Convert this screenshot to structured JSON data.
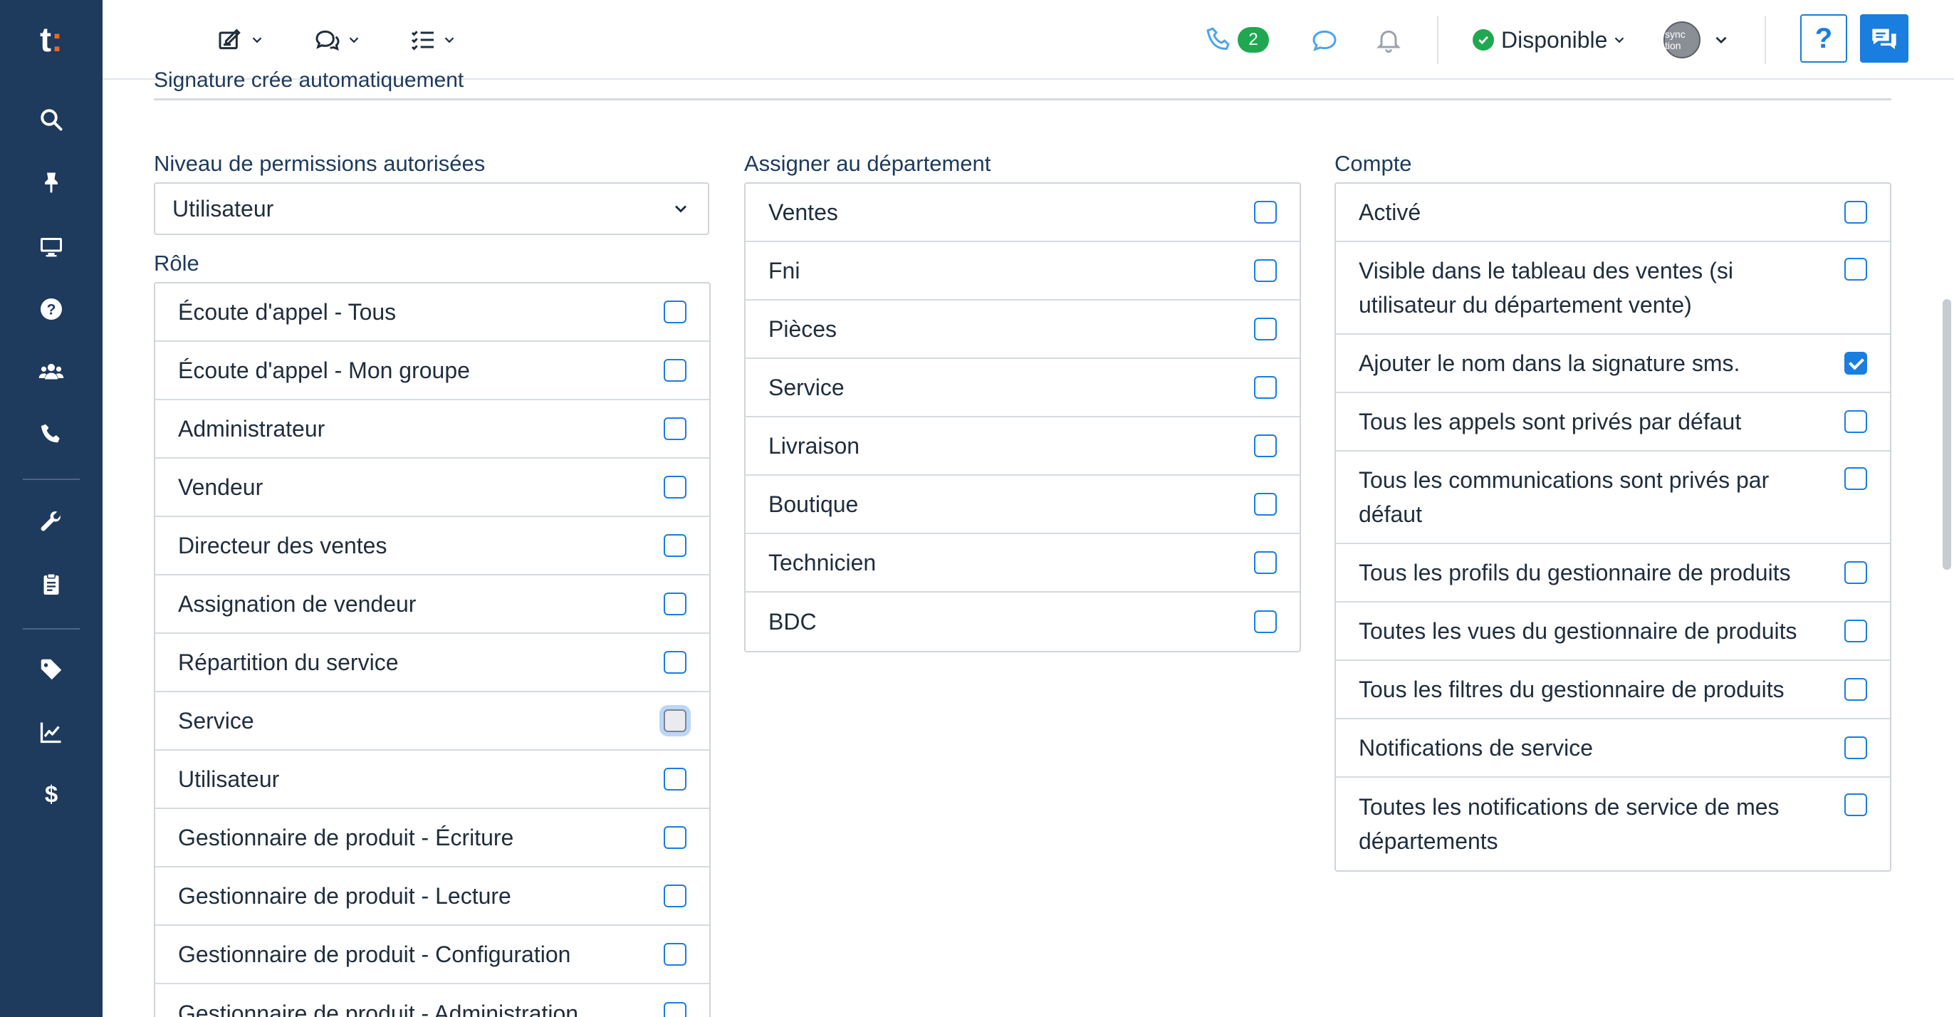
{
  "logo": {
    "main": "t",
    "accent": ":"
  },
  "topbar": {
    "phone_badge": "2",
    "status": "Disponible",
    "help_label": "?",
    "avatar_text": "sync tion"
  },
  "content": {
    "cut_title": "Signature crée automatiquement",
    "permissions_label": "Niveau de permissions autorisées",
    "permissions_value": "Utilisateur",
    "role_label": "Rôle",
    "dept_label": "Assigner au département",
    "account_label": "Compte"
  },
  "roles": [
    {
      "label": "Écoute d'appel - Tous",
      "checked": false
    },
    {
      "label": "Écoute d'appel - Mon groupe",
      "checked": false
    },
    {
      "label": "Administrateur",
      "checked": false
    },
    {
      "label": "Vendeur",
      "checked": false
    },
    {
      "label": "Directeur des ventes",
      "checked": false
    },
    {
      "label": "Assignation de vendeur",
      "checked": false
    },
    {
      "label": "Répartition du service",
      "checked": false
    },
    {
      "label": "Service",
      "checked": false,
      "focused": true
    },
    {
      "label": "Utilisateur",
      "checked": false
    },
    {
      "label": "Gestionnaire de produit - Écriture",
      "checked": false
    },
    {
      "label": "Gestionnaire de produit - Lecture",
      "checked": false
    },
    {
      "label": "Gestionnaire de produit - Configuration",
      "checked": false
    },
    {
      "label": "Gestionnaire de produit - Administration",
      "checked": false
    }
  ],
  "departments": [
    {
      "label": "Ventes",
      "checked": false
    },
    {
      "label": "Fni",
      "checked": false
    },
    {
      "label": "Pièces",
      "checked": false
    },
    {
      "label": "Service",
      "checked": false
    },
    {
      "label": "Livraison",
      "checked": false
    },
    {
      "label": "Boutique",
      "checked": false
    },
    {
      "label": "Technicien",
      "checked": false
    },
    {
      "label": "BDC",
      "checked": false
    }
  ],
  "account": [
    {
      "label": "Activé",
      "checked": false,
      "tall": false
    },
    {
      "label": "Visible dans le tableau des ventes (si utilisateur du département vente)",
      "checked": false,
      "tall": true
    },
    {
      "label": "Ajouter le nom dans la signature sms.",
      "checked": true,
      "tall": false
    },
    {
      "label": "Tous les appels sont privés par défaut",
      "checked": false,
      "tall": false
    },
    {
      "label": "Tous les communications sont privés par défaut",
      "checked": false,
      "tall": true
    },
    {
      "label": "Tous les profils du gestionnaire de produits",
      "checked": false,
      "tall": false
    },
    {
      "label": "Toutes les vues du gestionnaire de produits",
      "checked": false,
      "tall": false
    },
    {
      "label": "Tous les filtres du gestionnaire de produits",
      "checked": false,
      "tall": false
    },
    {
      "label": "Notifications de service",
      "checked": false,
      "tall": false
    },
    {
      "label": "Toutes les notifications de service de mes départements",
      "checked": false,
      "tall": true
    }
  ],
  "colors": {
    "sidebar": "#1e3a5c",
    "accent": "#1a7de0",
    "success": "#1fa84f",
    "logo_accent": "#f26522"
  },
  "icons": {
    "sidebar": [
      "search-icon",
      "pin-icon",
      "desktop-icon",
      "help-circle-icon",
      "users-icon",
      "phone-icon",
      "wrench-icon",
      "clipboard-icon",
      "tag-icon",
      "chart-line-icon",
      "dollar-icon"
    ],
    "topbar": [
      "edit-note-icon",
      "conversations-icon",
      "tasks-icon",
      "phone-icon",
      "chat-bubble-icon",
      "bell-icon",
      "check-circle-icon",
      "chevron-down-icon",
      "chat-window-icon"
    ]
  }
}
